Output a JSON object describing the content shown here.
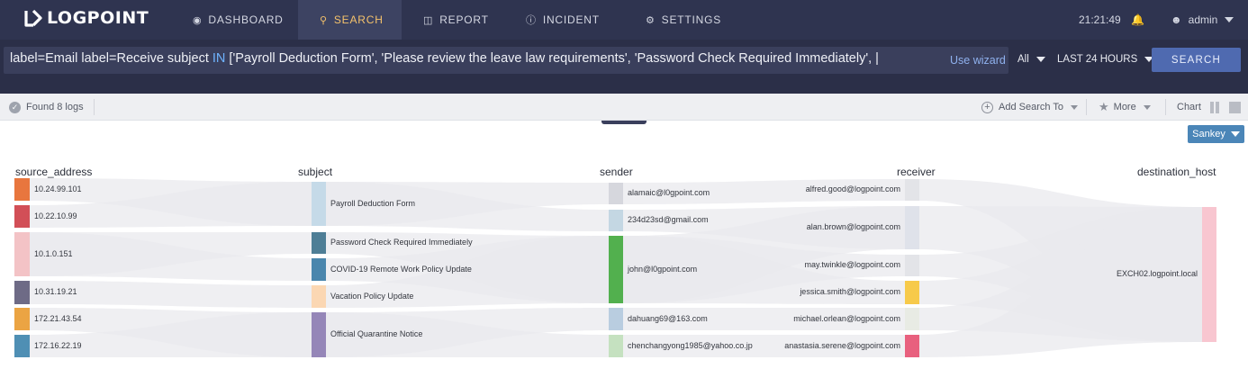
{
  "brand": "LOGPOINT",
  "nav": [
    {
      "label": "DASHBOARD",
      "icon": "dashboard-icon"
    },
    {
      "label": "SEARCH",
      "icon": "search-icon"
    },
    {
      "label": "REPORT",
      "icon": "report-icon"
    },
    {
      "label": "INCIDENT",
      "icon": "incident-icon"
    },
    {
      "label": "SETTINGS",
      "icon": "gear-icon"
    }
  ],
  "clock": "21:21:49",
  "user": "admin",
  "query": {
    "prefix": "label=Email label=Receive subject ",
    "keyword": "IN",
    "rest": " ['Payroll Deduction Form', 'Please review the leave law requirements', 'Password Check Required Immediately', |"
  },
  "use_wizard": "Use wizard",
  "scope_select": "All",
  "time_range": "LAST 24 HOURS",
  "search_button": "SEARCH",
  "found_logs": "Found 8 logs",
  "add_search_to": "Add Search To",
  "more": "More",
  "chart_label": "Chart",
  "sankey_button": "Sankey",
  "chart_data": {
    "type": "sankey",
    "columns": [
      "source_address",
      "subject",
      "sender",
      "receiver",
      "destination_host"
    ],
    "source_address": [
      {
        "name": "10.24.99.101",
        "color": "#e8763e"
      },
      {
        "name": "10.22.10.99",
        "color": "#d24f57"
      },
      {
        "name": "10.1.0.151",
        "color": "#f3c3c6"
      },
      {
        "name": "10.31.19.21",
        "color": "#6e6b86"
      },
      {
        "name": "172.21.43.54",
        "color": "#eba443"
      },
      {
        "name": "172.16.22.19",
        "color": "#4f8fb4"
      }
    ],
    "subject": [
      {
        "name": "Payroll Deduction Form",
        "color": "#c5dae8"
      },
      {
        "name": "Password Check Required Immediately",
        "color": "#4e7e96"
      },
      {
        "name": "COVID-19 Remote Work Policy Update",
        "color": "#4a86ad"
      },
      {
        "name": "Vacation Policy Update",
        "color": "#fbd7b3"
      },
      {
        "name": "Official Quarantine Notice",
        "color": "#9586b8"
      }
    ],
    "sender": [
      {
        "name": "alamaic@l0gpoint.com",
        "color": "#d6d7dd"
      },
      {
        "name": "234d23sd@gmail.com",
        "color": "#c4d7e3"
      },
      {
        "name": "john@l0gpoint.com",
        "color": "#52b04e"
      },
      {
        "name": "dahuang69@163.com",
        "color": "#b9cde0"
      },
      {
        "name": "chenchangyong1985@yahoo.co.jp",
        "color": "#c5e1c0"
      }
    ],
    "receiver": [
      {
        "name": "alfred.good@logpoint.com",
        "color": "#e3e4e8"
      },
      {
        "name": "alan.brown@logpoint.com",
        "color": "#dfe2ea"
      },
      {
        "name": "may.twinkle@logpoint.com",
        "color": "#e3e4e8"
      },
      {
        "name": "jessica.smith@logpoint.com",
        "color": "#f7ca4a"
      },
      {
        "name": "michael.orlean@logpoint.com",
        "color": "#e8ebe4"
      },
      {
        "name": "anastasia.serene@logpoint.com",
        "color": "#e8607e"
      }
    ],
    "destination_host": [
      {
        "name": "EXCH02.logpoint.local",
        "color": "#f8c6d0"
      }
    ]
  }
}
